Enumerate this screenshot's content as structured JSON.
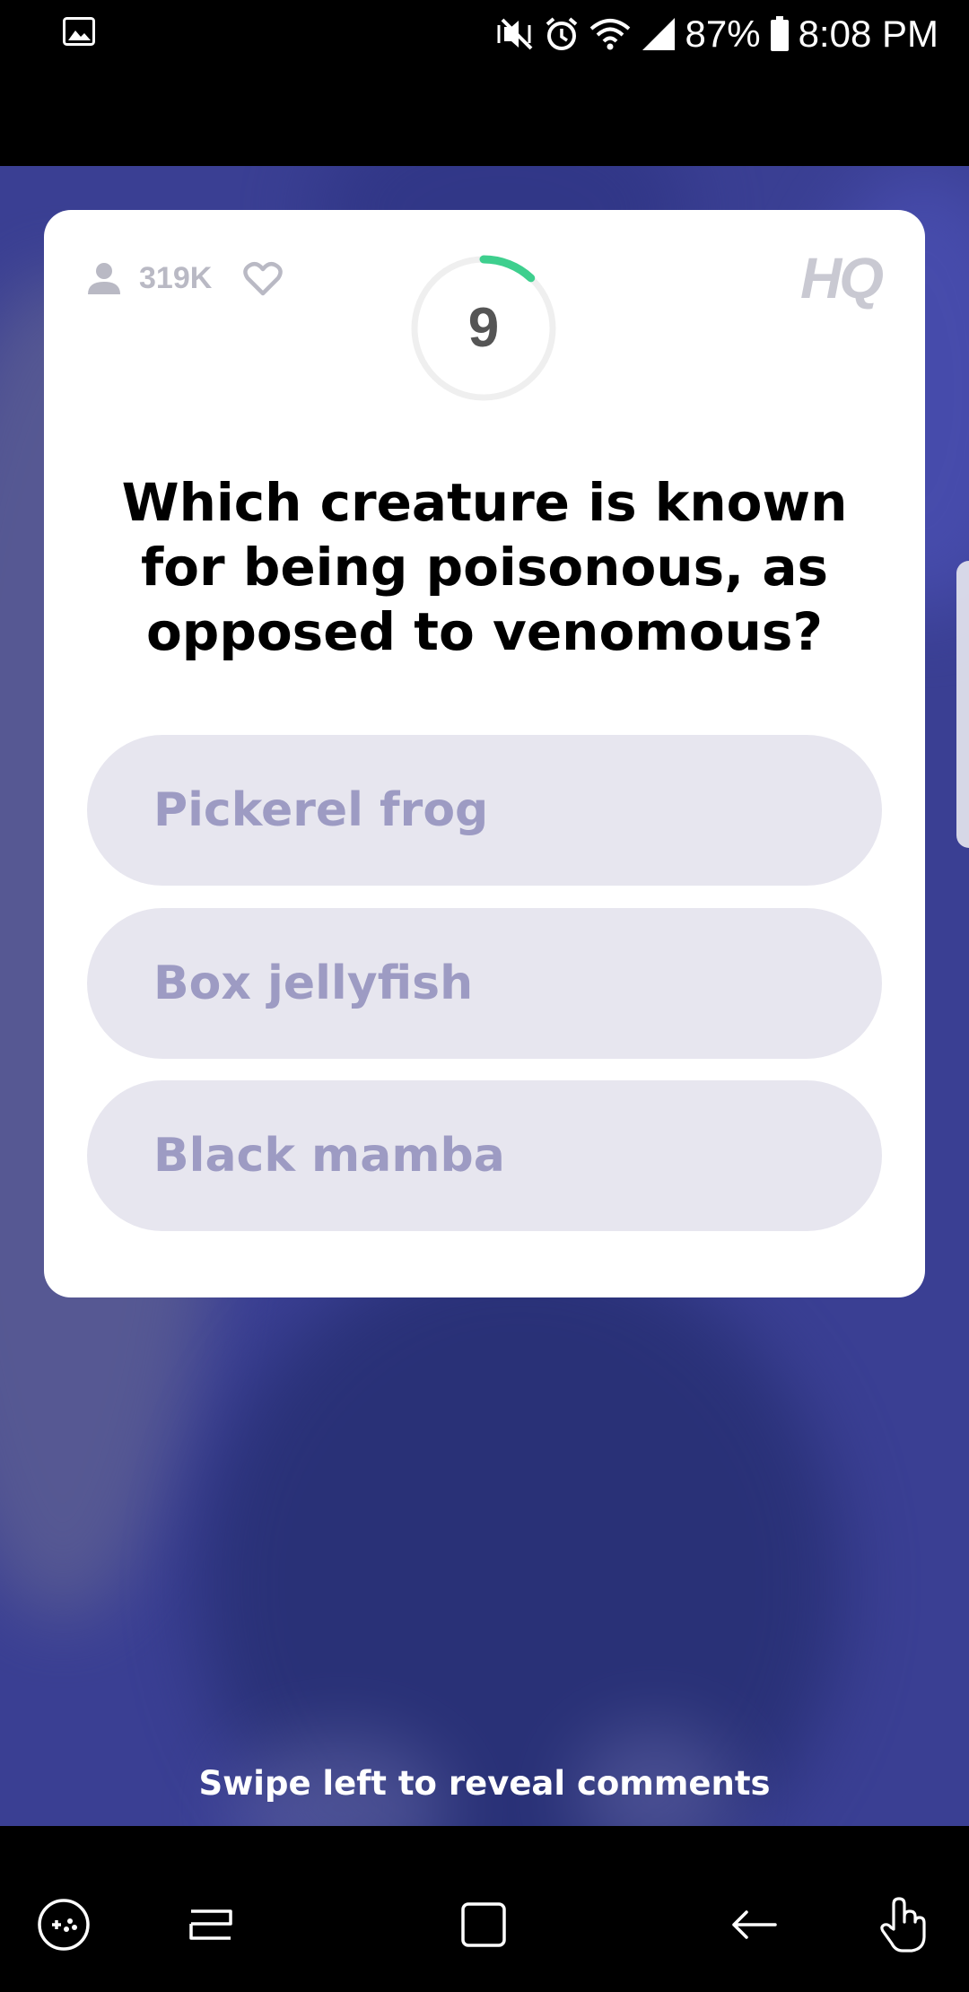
{
  "status_bar": {
    "battery_percent": "87%",
    "time": "8:08 PM",
    "icons": [
      "gallery-icon",
      "mute-vibrate-icon",
      "alarm-icon",
      "wifi-icon",
      "signal-icon",
      "battery-icon"
    ]
  },
  "card": {
    "viewer_count": "319K",
    "timer_value": "9",
    "timer_progress": 0.12,
    "logo": "HQ",
    "question": "Which creature is known for being poisonous, as opposed to venomous?",
    "answers": [
      {
        "label": "Pickerel frog"
      },
      {
        "label": "Box jellyfish"
      },
      {
        "label": "Black mamba"
      }
    ]
  },
  "swipe_hint": "Swipe left to reveal comments",
  "nav_bar": {
    "buttons": [
      "game-tools-icon",
      "recents-icon",
      "home-icon",
      "back-icon",
      "touch-icon"
    ]
  },
  "colors": {
    "card_bg": "#ffffff",
    "answer_bg": "#e7e6ef",
    "answer_text": "#9d9bc3",
    "timer_accent": "#3ecf8e",
    "video_bg": "#3a3f93"
  }
}
